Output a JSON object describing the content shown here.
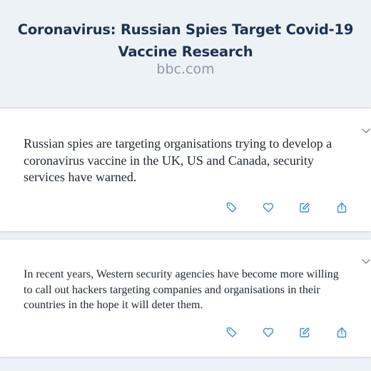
{
  "header": {
    "title": "Coronavirus: Russian Spies Target Covid-19 Vaccine Research",
    "source": "bbc.com"
  },
  "cards": [
    {
      "text": "Russian spies are targeting organisations trying to develop a coronavirus vaccine in the UK, US and Canada, security services have warned.",
      "icons": [
        "tag-icon",
        "heart-icon",
        "edit-icon",
        "share-icon"
      ]
    },
    {
      "text": "In recent years, Western security agencies have become more willing to call out hackers targeting companies and organisations in their countries in the hope it will deter them.",
      "icons": [
        "tag-icon",
        "heart-icon",
        "edit-icon",
        "share-icon"
      ]
    }
  ],
  "colors": {
    "background": "#edf2f6",
    "title": "#1b3350",
    "source": "#8d9aa8",
    "accent": "#3b8ee0",
    "body_text": "#222a33"
  }
}
